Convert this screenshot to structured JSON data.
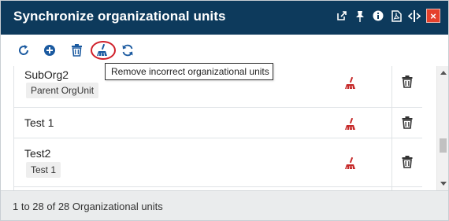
{
  "window": {
    "title": "Synchronize organizational units",
    "title_icons": [
      "popout-icon",
      "pin-icon",
      "info-icon",
      "pdf-icon",
      "resize-width-icon",
      "close-icon"
    ],
    "close_label": "×"
  },
  "toolbar": {
    "buttons": [
      "refresh-icon",
      "add-icon",
      "delete-icon",
      "cleanup-icon",
      "sync-icon"
    ],
    "tooltip": "Remove incorrect organizational units"
  },
  "colors": {
    "titlebar": "#0d3a5c",
    "toolbar_icon": "#1b5aa0",
    "broom": "#c62828",
    "highlight": "#d0202a"
  },
  "rows": [
    {
      "name": "SubOrg2",
      "parent": "Parent OrgUnit"
    },
    {
      "name": "Test 1",
      "parent": ""
    },
    {
      "name": "Test2",
      "parent": "Test 1"
    }
  ],
  "footer": {
    "summary": "1 to 28 of 28 Organizational units"
  }
}
